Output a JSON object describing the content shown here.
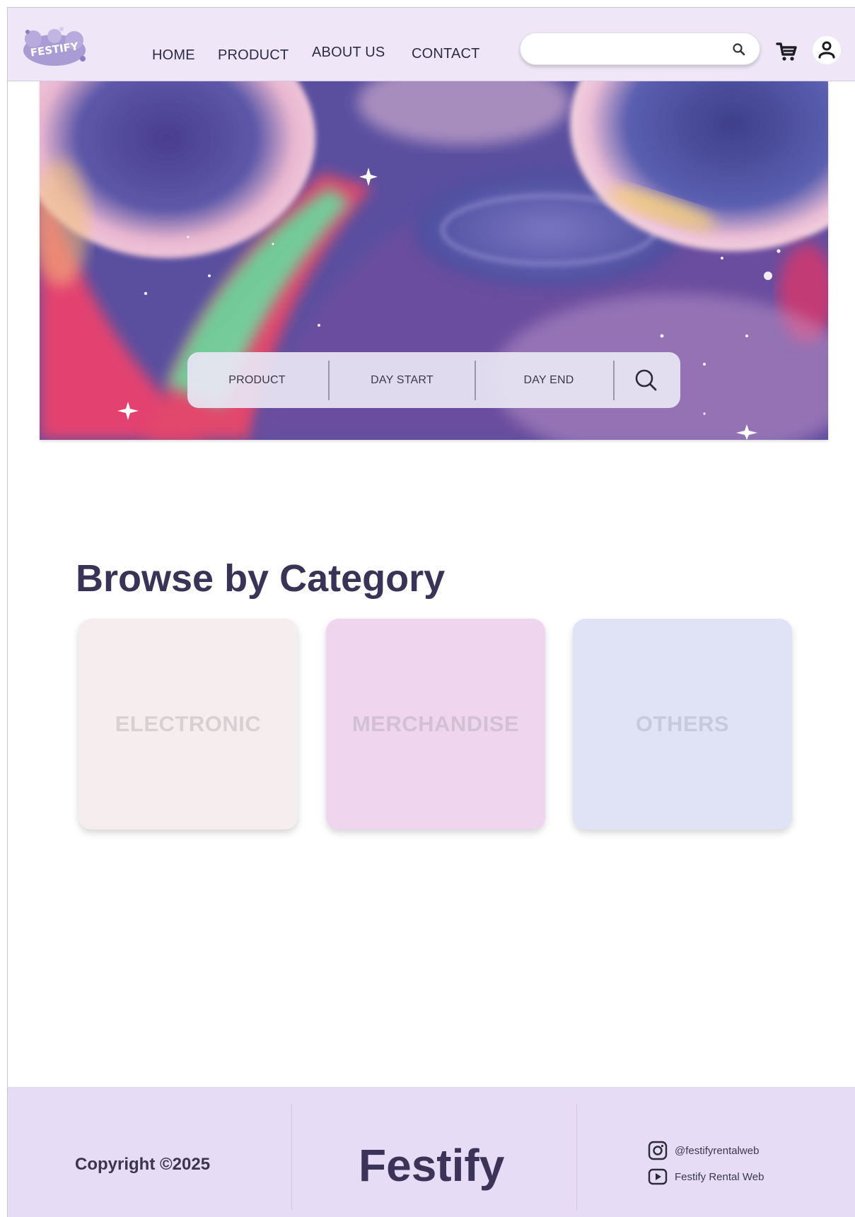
{
  "header": {
    "logo_text": "FESTIFY",
    "nav": [
      "HOME",
      "PRODUCT",
      "ABOUT US",
      "CONTACT"
    ],
    "search_placeholder": ""
  },
  "hero": {
    "booking": {
      "product_label": "PRODUCT",
      "day_start_label": "DAY START",
      "day_end_label": "DAY END"
    }
  },
  "categories": {
    "title": "Browse by Category",
    "items": [
      {
        "label": "ELECTRONIC",
        "color": "#f6eeee"
      },
      {
        "label": "MERCHANDISE",
        "color": "#efd6ee"
      },
      {
        "label": "OTHERS",
        "color": "#e0e2f6"
      }
    ]
  },
  "footer": {
    "copyright": "Copyright ©2025",
    "brand": "Festify",
    "instagram": "@festifyrentalweb",
    "youtube": "Festify Rental Web"
  },
  "colors": {
    "header_bg": "#efe6f8",
    "footer_bg": "#e7dcf6",
    "heading": "#3a3358"
  }
}
